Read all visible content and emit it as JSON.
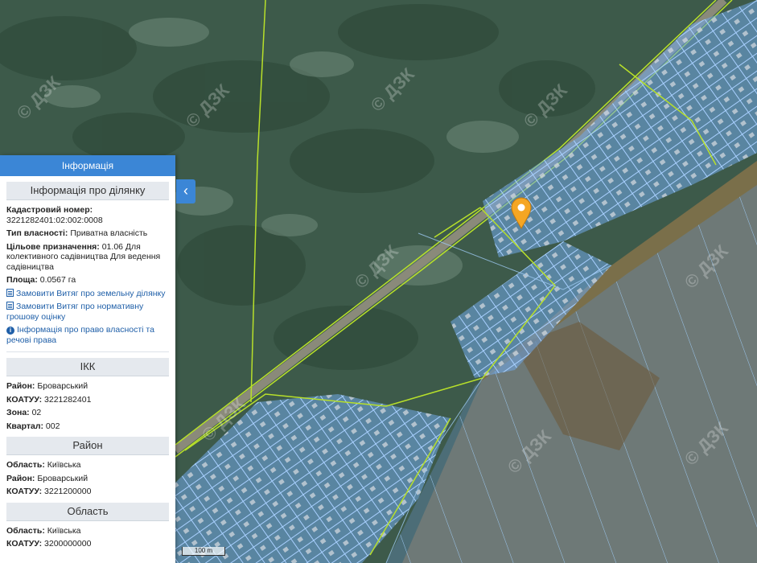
{
  "panel": {
    "header": "Інформація",
    "parcel": {
      "title": "Інформація про ділянку",
      "cadastral_label": "Кадастровий номер:",
      "cadastral_value": "3221282401:02:002:0008",
      "ownership_label": "Тип власності:",
      "ownership_value": "Приватна власність",
      "purpose_label": "Цільове призначення:",
      "purpose_value": "01.06 Для колективного садівництва Для ведення садівництва",
      "area_label": "Площа:",
      "area_value": "0.0567 га",
      "link_extract": "Замовити Витяг про земельну ділянку",
      "link_valuation": "Замовити Витяг про нормативну грошову оцінку",
      "link_rights": "Інформація про право власності та речові права"
    },
    "ikk": {
      "title": "ІКК",
      "district_label": "Район:",
      "district_value": "Броварський",
      "koatuu_label": "КОАТУУ:",
      "koatuu_value": "3221282401",
      "zone_label": "Зона:",
      "zone_value": "02",
      "quarter_label": "Квартал:",
      "quarter_value": "002"
    },
    "rayon": {
      "title": "Район",
      "oblast_label": "Область:",
      "oblast_value": "Київська",
      "district_label": "Район:",
      "district_value": "Броварський",
      "koatuu_label": "КОАТУУ:",
      "koatuu_value": "3221200000"
    },
    "oblast": {
      "title": "Область",
      "oblast_label": "Область:",
      "oblast_value": "Київська",
      "koatuu_label": "КОАТУУ:",
      "koatuu_value": "3200000000"
    }
  },
  "toggle_icon": "chevron-left-icon",
  "toggle_glyph": "‹",
  "scale": "100 m",
  "watermark": "© ДЗК",
  "colors": {
    "panel_header": "#3b86d6",
    "link": "#1f5fa8",
    "parcel_fill": "#6fa8e8",
    "boundary": "#b8e02a",
    "marker": "#f5a623"
  }
}
